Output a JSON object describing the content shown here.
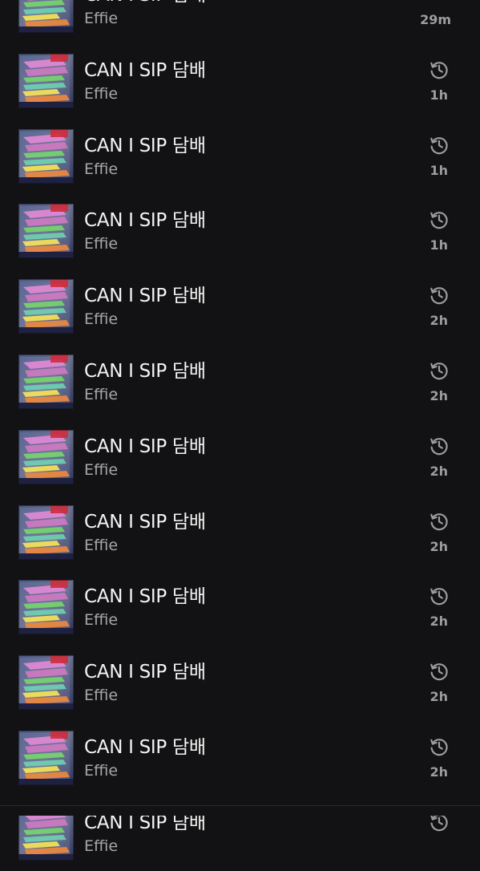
{
  "history": {
    "items": [
      {
        "title": "CAN I SIP 담배",
        "artist": "Effie",
        "time": "29m",
        "icon": "history-icon"
      },
      {
        "title": "CAN I SIP 담배",
        "artist": "Effie",
        "time": "1h",
        "icon": "history-icon"
      },
      {
        "title": "CAN I SIP 담배",
        "artist": "Effie",
        "time": "1h",
        "icon": "history-icon"
      },
      {
        "title": "CAN I SIP 담배",
        "artist": "Effie",
        "time": "1h",
        "icon": "history-icon"
      },
      {
        "title": "CAN I SIP 담배",
        "artist": "Effie",
        "time": "2h",
        "icon": "history-icon"
      },
      {
        "title": "CAN I SIP 담배",
        "artist": "Effie",
        "time": "2h",
        "icon": "history-icon"
      },
      {
        "title": "CAN I SIP 담배",
        "artist": "Effie",
        "time": "2h",
        "icon": "history-icon"
      },
      {
        "title": "CAN I SIP 담배",
        "artist": "Effie",
        "time": "2h",
        "icon": "history-icon"
      },
      {
        "title": "CAN I SIP 담배",
        "artist": "Effie",
        "time": "2h",
        "icon": "history-icon"
      },
      {
        "title": "CAN I SIP 담배",
        "artist": "Effie",
        "time": "2h",
        "icon": "history-icon"
      },
      {
        "title": "CAN I SIP 담배",
        "artist": "Effie",
        "time": "2h",
        "icon": "history-icon"
      },
      {
        "title": "CAN I SIP 담배",
        "artist": "Effie",
        "time": "",
        "icon": "history-icon"
      }
    ]
  },
  "colors": {
    "background": "#121214",
    "title": "#f4f4f4",
    "subtitle": "#a7a7a9",
    "meta": "#9d9d9f"
  }
}
